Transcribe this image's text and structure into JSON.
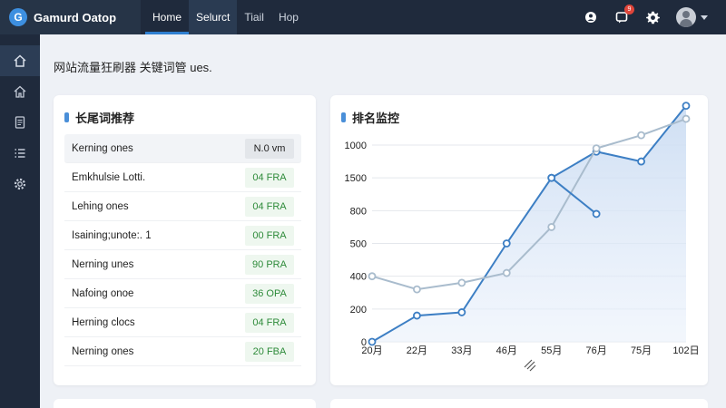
{
  "app": {
    "name": "Gamurd Oatop",
    "logo_letter": "G"
  },
  "nav": [
    {
      "label": "Home",
      "state": "active"
    },
    {
      "label": "Selurct",
      "state": "selected"
    },
    {
      "label": "Tiail",
      "state": ""
    },
    {
      "label": "Hop",
      "state": ""
    }
  ],
  "topbar": {
    "notification_count": "9"
  },
  "page": {
    "title": "网站流量狂刷器 关键词管 ues."
  },
  "keywords_card": {
    "title": "长尾词推荐",
    "header": {
      "name": "Kerning ones",
      "value": "N.0 vm"
    },
    "rows": [
      {
        "name": "Emkhulsie Lotti.",
        "value": "04 FRA"
      },
      {
        "name": "Lehing ones",
        "value": "04 FRA"
      },
      {
        "name": "Isaining;unote:. 1",
        "value": "00 FRA"
      },
      {
        "name": "Nerning unes",
        "value": "90 PRA"
      },
      {
        "name": "Nafoing onoe",
        "value": "36 OPA"
      },
      {
        "name": "Herning clocs",
        "value": "04 FRA"
      },
      {
        "name": "Nerning ones",
        "value": "20 FBA"
      }
    ]
  },
  "chart_card": {
    "title": "排名监控"
  },
  "chart_data": {
    "type": "line",
    "categories": [
      "20月",
      "22月",
      "33月",
      "46月",
      "55月",
      "76月",
      "75月",
      "102日"
    ],
    "ytick_labels": [
      "0",
      "200",
      "400",
      "500",
      "800",
      "1500",
      "1000"
    ],
    "xlabel_icon": "trend-icon",
    "series": [
      {
        "color": "#3d7fc4",
        "points": [
          [
            0,
            0.0
          ],
          [
            1,
            0.8
          ],
          [
            2,
            0.9
          ],
          [
            3,
            3.0
          ],
          [
            4,
            5.0
          ],
          [
            5,
            5.8
          ],
          [
            6,
            5.5
          ],
          [
            7,
            7.2
          ]
        ],
        "area": true
      },
      {
        "color": "#a9bccd",
        "points": [
          [
            0,
            2.0
          ],
          [
            1,
            1.6
          ],
          [
            2,
            1.8
          ],
          [
            3,
            2.1
          ],
          [
            4,
            3.5
          ],
          [
            5,
            5.9
          ],
          [
            6,
            6.3
          ],
          [
            7,
            6.8
          ]
        ],
        "area": false
      },
      {
        "color": "#3d7fc4",
        "points": [
          [
            4,
            5.0
          ],
          [
            5,
            3.9
          ]
        ],
        "area": false
      }
    ],
    "grid": true
  }
}
